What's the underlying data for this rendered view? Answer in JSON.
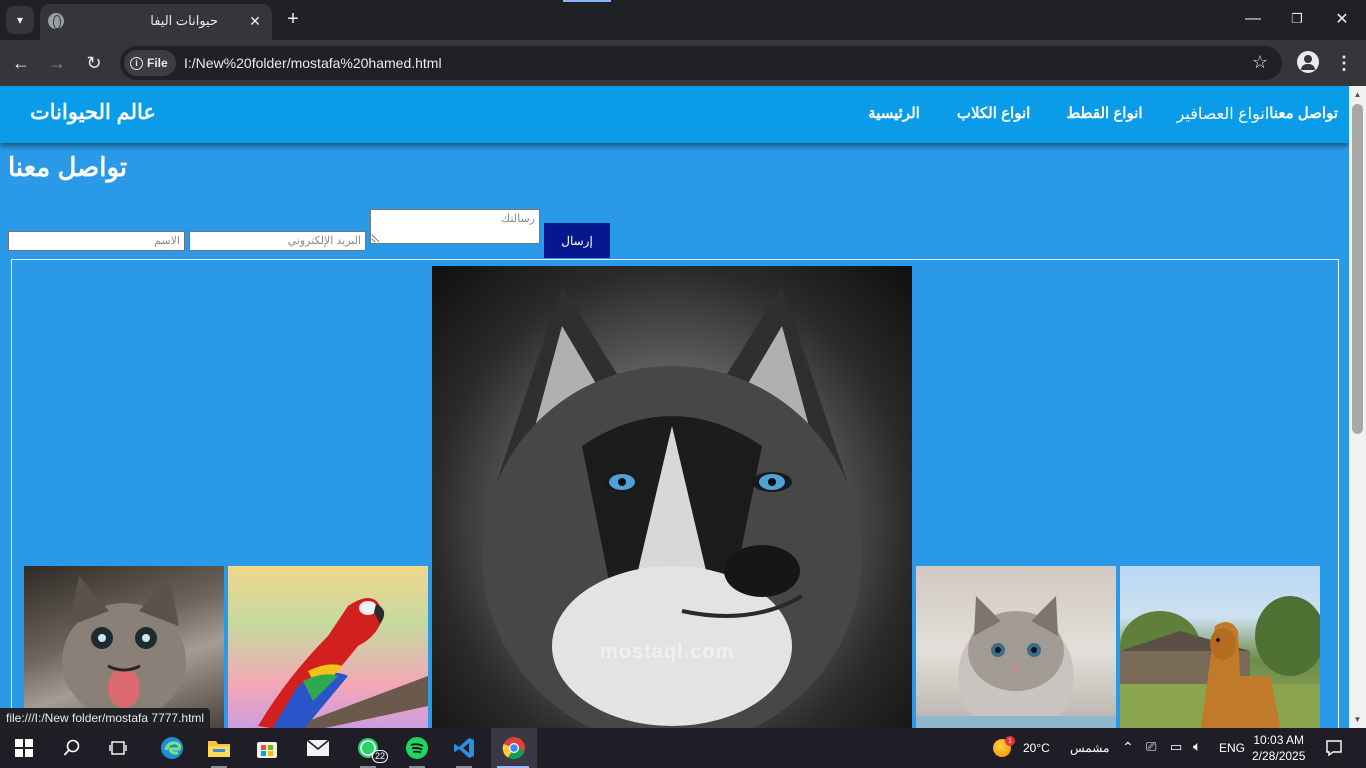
{
  "browser": {
    "tab_title": "حيوانات اليفا",
    "site_chip": "File",
    "url": "I:/New%20folder/mostafa%20hamed.html",
    "status_tooltip": "file:///I:/New folder/mostafa 7777.html"
  },
  "header": {
    "logo": "عالم الحيوانات",
    "nav": [
      "تواصل معنا",
      "انواع العصافير",
      "انواع القطط",
      "انواع الكلاب",
      "الرئيسية"
    ]
  },
  "contact": {
    "title": "تواصل معنا",
    "name_placeholder": "الاسم",
    "email_placeholder": "البريد الإلكتروني",
    "message_placeholder": "رسالتك",
    "send_label": "إرسال"
  },
  "watermark": "mostaql.com",
  "taskbar": {
    "whatsapp_badge": "22",
    "weather_temp": "20°C",
    "weather_label": "مشمس",
    "weather_alert": "1",
    "language": "ENG",
    "time": "10:03 AM",
    "date": "2/28/2025"
  }
}
